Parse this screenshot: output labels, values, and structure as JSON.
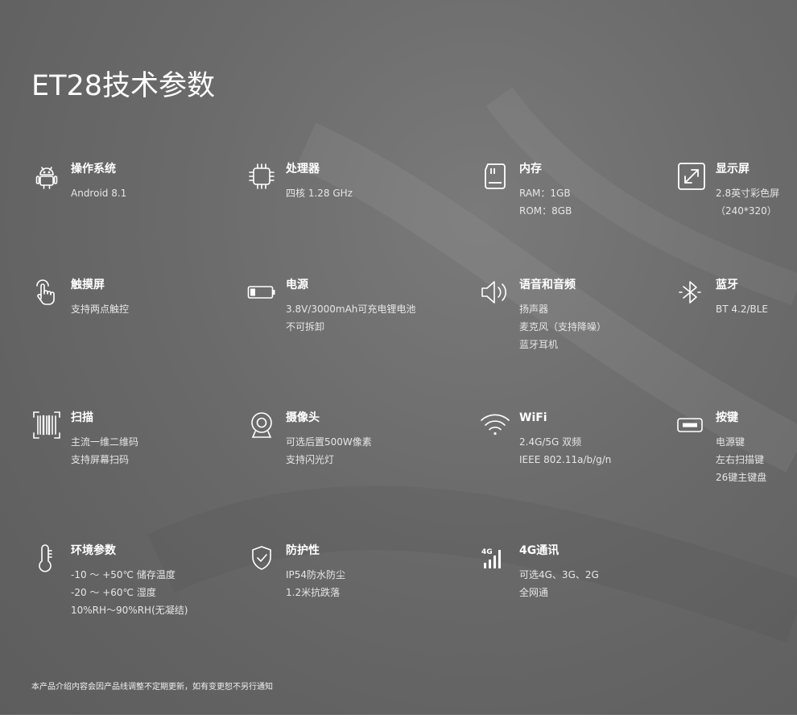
{
  "title": "ET28技术参数",
  "specs": [
    {
      "icon": "android-icon",
      "label": "操作系统",
      "lines": [
        "Android 8.1"
      ]
    },
    {
      "icon": "cpu-icon",
      "label": "处理器",
      "lines": [
        "四核 1.28 GHz"
      ]
    },
    {
      "icon": "memory-card-icon",
      "label": "内存",
      "lines": [
        "RAM：1GB",
        "ROM：8GB"
      ]
    },
    {
      "icon": "expand-screen-icon",
      "label": "显示屏",
      "lines": [
        "2.8英寸彩色屏",
        "（240*320）"
      ]
    },
    {
      "icon": "touch-hand-icon",
      "label": "触摸屏",
      "lines": [
        "支持两点触控"
      ]
    },
    {
      "icon": "battery-icon",
      "label": "电源",
      "lines": [
        "3.8V/3000mAh可充电锂电池",
        "不可拆卸"
      ]
    },
    {
      "icon": "speaker-icon",
      "label": "语音和音频",
      "lines": [
        "扬声器",
        "麦克风（支持降噪）",
        "蓝牙耳机"
      ]
    },
    {
      "icon": "bluetooth-icon",
      "label": "蓝牙",
      "lines": [
        "BT 4.2/BLE"
      ]
    },
    {
      "icon": "barcode-scan-icon",
      "label": "扫描",
      "lines": [
        "主流一维二维码",
        "支持屏幕扫码"
      ]
    },
    {
      "icon": "camera-icon",
      "label": "摄像头",
      "lines": [
        "可选后置500W像素",
        "支持闪光灯"
      ]
    },
    {
      "icon": "wifi-icon",
      "label": "WiFi",
      "lines": [
        "2.4G/5G 双频",
        "IEEE 802.11a/b/g/n"
      ]
    },
    {
      "icon": "key-button-icon",
      "label": "按键",
      "lines": [
        "电源键",
        "左右扫描键",
        "26键主键盘"
      ]
    },
    {
      "icon": "thermometer-icon",
      "label": "环境参数",
      "lines": [
        "-10 ～ +50℃ 储存温度",
        "-20 ～ +60℃ 湿度",
        "10%RH～90%RH(无凝结)"
      ]
    },
    {
      "icon": "shield-check-icon",
      "label": "防护性",
      "lines": [
        "IP54防水防尘",
        "1.2米抗跌落"
      ]
    },
    {
      "icon": "signal-4g-icon",
      "label": "4G通讯",
      "lines": [
        "可选4G、3G、2G",
        "全网通"
      ]
    }
  ],
  "signal_text": "4G",
  "footnote": "本产品介绍内容会因产品线调整不定期更新，如有变更恕不另行通知"
}
